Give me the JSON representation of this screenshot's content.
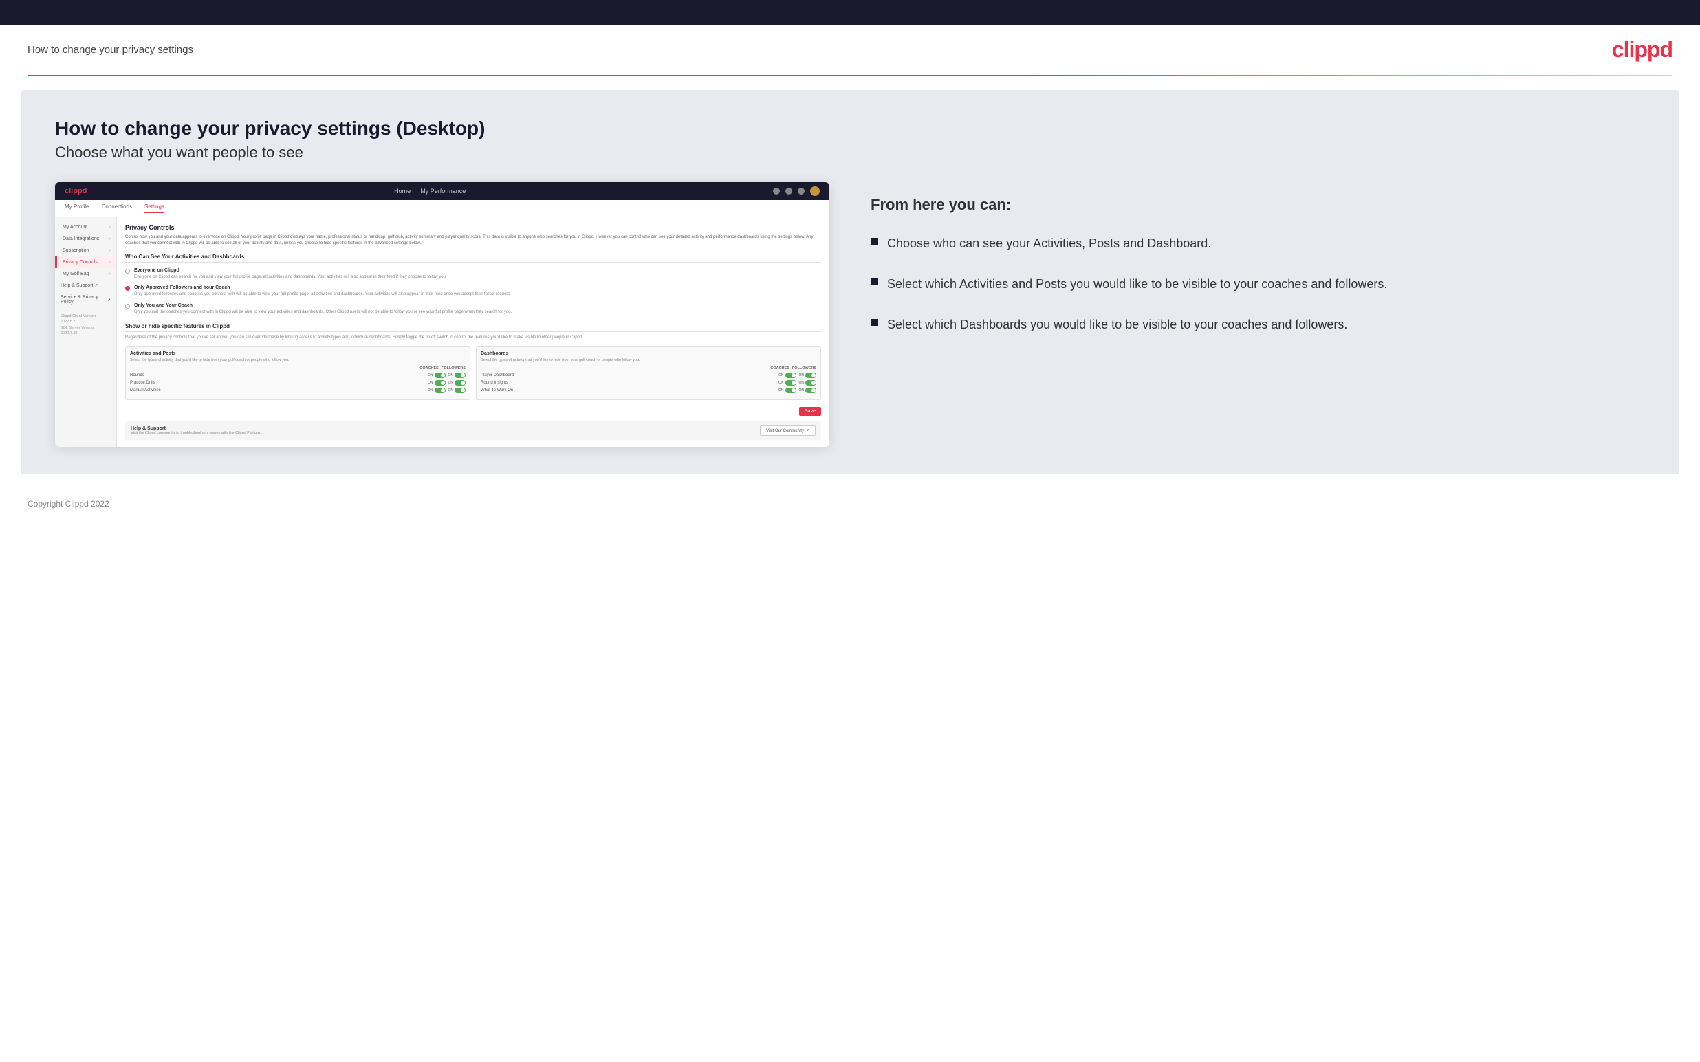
{
  "topBar": {},
  "header": {
    "title": "How to change your privacy settings",
    "logo": "clippd"
  },
  "main": {
    "heading": "How to change your privacy settings (Desktop)",
    "subheading": "Choose what you want people to see",
    "rightPanel": {
      "fromHereTitle": "From here you can:",
      "bullets": [
        "Choose who can see your Activities, Posts and Dashboard.",
        "Select which Activities and Posts you would like to be visible to your coaches and followers.",
        "Select which Dashboards you would like to be visible to your coaches and followers."
      ]
    }
  },
  "mockup": {
    "nav": {
      "logo": "clippd",
      "links": [
        "Home",
        "My Performance"
      ]
    },
    "subnav": {
      "items": [
        "My Profile",
        "Connections",
        "Settings"
      ]
    },
    "sidebar": {
      "items": [
        {
          "label": "My Account",
          "active": false
        },
        {
          "label": "Data Integrations",
          "active": false
        },
        {
          "label": "Subscription",
          "active": false
        },
        {
          "label": "Privacy Controls",
          "active": true
        },
        {
          "label": "My Golf Bag",
          "active": false
        }
      ],
      "links": [
        {
          "label": "Help & Support"
        },
        {
          "label": "Service & Privacy Policy"
        }
      ],
      "version": "Clippd Client Version: 2022.8.2\nSQL Server Version: 2022.7.38"
    },
    "privacyControls": {
      "sectionTitle": "Privacy Controls",
      "description": "Control how you and your data appears to everyone on Clippd. Your profile page in Clippd displays your name, professional status or handicap, golf club, activity summary and player quality score. This data is visible to anyone who searches for you in Clippd. However you can control who can see your detailed activity and performance dashboards using the settings below. Any coaches that you connect with in Clippd will be able to see all of your activity and data, unless you choose to hide specific features in the advanced settings below.",
      "whoCanSee": {
        "title": "Who Can See Your Activities and Dashboards",
        "options": [
          {
            "label": "Everyone on Clippd",
            "desc": "Everyone on Clippd can search for you and view your full profile page, all activities and dashboards. Your activities will also appear in their feed if they choose to follow you.",
            "selected": false
          },
          {
            "label": "Only Approved Followers and Your Coach",
            "desc": "Only approved followers and coaches you connect with will be able to view your full profile page, all activities and dashboards. Your activities will also appear in their feed once you accept their follow request.",
            "selected": true
          },
          {
            "label": "Only You and Your Coach",
            "desc": "Only you and the coaches you connect with in Clippd will be able to view your activities and dashboards. Other Clippd users will not be able to follow you or see your full profile page when they search for you.",
            "selected": false
          }
        ]
      },
      "showHide": {
        "title": "Show or hide specific features in Clippd",
        "desc": "Regardless of the privacy controls that you've set above, you can still override these by limiting access to activity types and individual dashboards. Simply toggle the on/off switch to control the features you'd like to make visible to other people in Clippd.",
        "activitiesAndPosts": {
          "title": "Activities and Posts",
          "desc": "Select the types of activity that you'd like to hide from your golf coach or people who follow you.",
          "colHeaders": [
            "COACHES",
            "FOLLOWERS"
          ],
          "rows": [
            {
              "label": "Rounds",
              "coaches": true,
              "followers": true
            },
            {
              "label": "Practice Drills",
              "coaches": true,
              "followers": true
            },
            {
              "label": "Manual Activities",
              "coaches": true,
              "followers": true
            }
          ]
        },
        "dashboards": {
          "title": "Dashboards",
          "desc": "Select the types of activity that you'd like to hide from your golf coach or people who follow you.",
          "colHeaders": [
            "COACHES",
            "FOLLOWERS"
          ],
          "rows": [
            {
              "label": "Player Dashboard",
              "coaches": true,
              "followers": true
            },
            {
              "label": "Round Insights",
              "coaches": true,
              "followers": true
            },
            {
              "label": "What To Work On",
              "coaches": true,
              "followers": true
            }
          ]
        }
      },
      "saveLabel": "Save",
      "help": {
        "title": "Help & Support",
        "desc": "Visit the Clippd community to troubleshoot any issues with the Clippd Platform.",
        "btnLabel": "Visit Our Community"
      }
    }
  },
  "footer": {
    "copyright": "Copyright Clippd 2022"
  }
}
